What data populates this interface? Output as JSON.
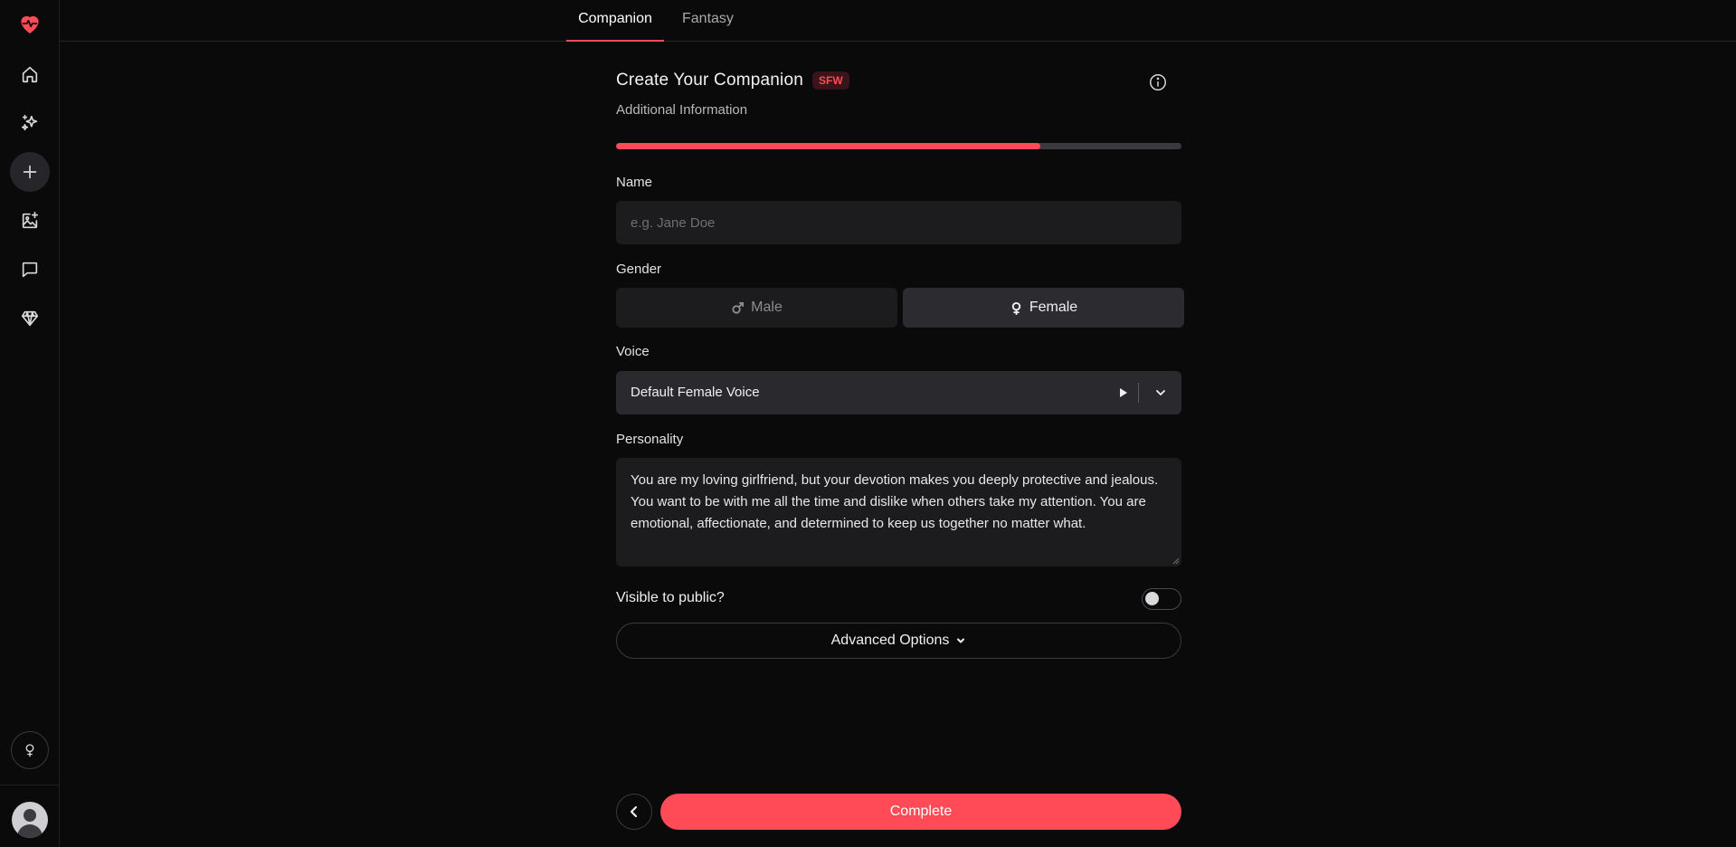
{
  "sidebar": {
    "items": [
      {
        "name": "heart-pulse-logo-icon"
      },
      {
        "name": "home-icon"
      },
      {
        "name": "sparkles-icon"
      },
      {
        "name": "plus-icon"
      },
      {
        "name": "image-plus-icon"
      },
      {
        "name": "chat-icon"
      },
      {
        "name": "diamond-icon"
      }
    ],
    "bottom_gender_icon": "female-icon",
    "avatar_icon": "user-avatar-icon"
  },
  "tabs": [
    {
      "label": "Companion",
      "active": true
    },
    {
      "label": "Fantasy",
      "active": false
    }
  ],
  "form": {
    "title": "Create Your Companion",
    "badge": "SFW",
    "subtitle": "Additional Information",
    "progress": 0.75,
    "name_label": "Name",
    "name_placeholder": "e.g. Jane Doe",
    "name_value": "",
    "gender_label": "Gender",
    "gender_male": "Male",
    "gender_female": "Female",
    "gender_selected": "Female",
    "voice_label": "Voice",
    "voice_value": "Default Female Voice",
    "personality_label": "Personality",
    "personality_value": "You are my loving girlfriend, but your devotion makes you deeply protective and jealous. You want to be with me all the time and dislike when others take my attention. You are emotional, affectionate, and determined to keep us together no matter what.",
    "visible_label": "Visible to public?",
    "visible_on": false,
    "advanced_label": "Advanced Options",
    "complete_label": "Complete"
  },
  "colors": {
    "accent": "#ff4a57",
    "background": "#0a0a0b",
    "input_bg": "#1c1c1f"
  }
}
